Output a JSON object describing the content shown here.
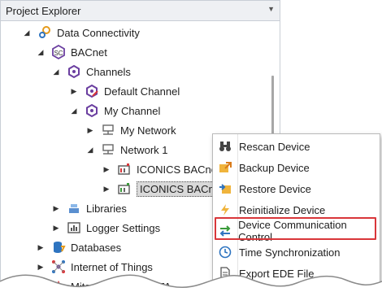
{
  "header": {
    "title": "Project Explorer"
  },
  "tree": {
    "data_connectivity": "Data Connectivity",
    "bacnet": "BACnet",
    "channels": "Channels",
    "default_channel": "Default Channel",
    "my_channel": "My Channel",
    "my_network": "My Network",
    "network1": "Network 1",
    "device1": "ICONICS BACnet -",
    "device2": "ICONICS BACnet -",
    "libraries": "Libraries",
    "logger_settings": "Logger Settings",
    "databases": "Databases",
    "iot": "Internet of Things",
    "mitsubishi": "Mitsubishi Electric FA"
  },
  "context_menu": {
    "items": [
      {
        "label": "Rescan Device",
        "icon": "binoculars-icon"
      },
      {
        "label": "Backup Device",
        "icon": "backup-icon"
      },
      {
        "label": "Restore Device",
        "icon": "restore-icon"
      },
      {
        "label": "Reinitialize Device",
        "icon": "lightning-icon"
      },
      {
        "label": "Device Communication Control",
        "icon": "swap-arrows-icon"
      },
      {
        "label": "Time Synchronization",
        "icon": "clock-icon"
      },
      {
        "label": "Export EDE File",
        "icon": "export-file-icon"
      }
    ],
    "highlighted_item": "Device Communication Control"
  },
  "colors": {
    "highlight": "#d9363a",
    "accent": "#2e74c0",
    "purple": "#6b3fa0"
  }
}
